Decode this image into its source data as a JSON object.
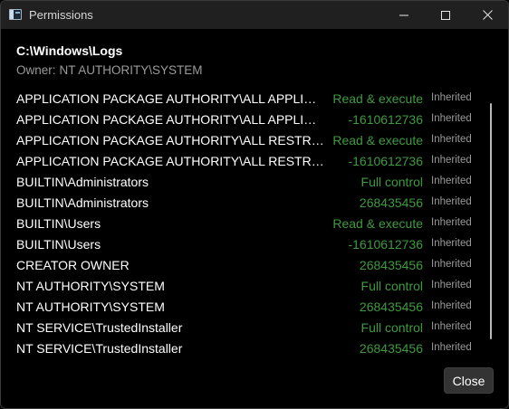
{
  "window": {
    "title": "Permissions",
    "icon": "window-app-icon"
  },
  "header": {
    "path": "C:\\Windows\\Logs",
    "owner_label": "Owner:",
    "owner_value": "NT AUTHORITY\\SYSTEM"
  },
  "permissions": [
    {
      "principal": "APPLICATION PACKAGE AUTHORITY\\ALL APPLICATION PACKAGES",
      "access": "Read & execute",
      "inherited": "Inherited"
    },
    {
      "principal": "APPLICATION PACKAGE AUTHORITY\\ALL APPLICATION PACKAGES",
      "access": "-1610612736",
      "inherited": "Inherited"
    },
    {
      "principal": "APPLICATION PACKAGE AUTHORITY\\ALL RESTRICTED APPLICATION PACKAGES",
      "access": "Read & execute",
      "inherited": "Inherited"
    },
    {
      "principal": "APPLICATION PACKAGE AUTHORITY\\ALL RESTRICTED APPLICATION PACKAGES",
      "access": "-1610612736",
      "inherited": "Inherited"
    },
    {
      "principal": "BUILTIN\\Administrators",
      "access": "Full control",
      "inherited": "Inherited"
    },
    {
      "principal": "BUILTIN\\Administrators",
      "access": "268435456",
      "inherited": "Inherited"
    },
    {
      "principal": "BUILTIN\\Users",
      "access": "Read & execute",
      "inherited": "Inherited"
    },
    {
      "principal": "BUILTIN\\Users",
      "access": "-1610612736",
      "inherited": "Inherited"
    },
    {
      "principal": "CREATOR OWNER",
      "access": "268435456",
      "inherited": "Inherited"
    },
    {
      "principal": "NT AUTHORITY\\SYSTEM",
      "access": "Full control",
      "inherited": "Inherited"
    },
    {
      "principal": "NT AUTHORITY\\SYSTEM",
      "access": "268435456",
      "inherited": "Inherited"
    },
    {
      "principal": "NT SERVICE\\TrustedInstaller",
      "access": "Full control",
      "inherited": "Inherited"
    },
    {
      "principal": "NT SERVICE\\TrustedInstaller",
      "access": "268435456",
      "inherited": "Inherited"
    }
  ],
  "footer": {
    "close_label": "Close"
  },
  "colors": {
    "background": "#000000",
    "titlebar": "#202020",
    "access_green": "#3f9a3f",
    "muted_text": "#9a9a9a"
  }
}
